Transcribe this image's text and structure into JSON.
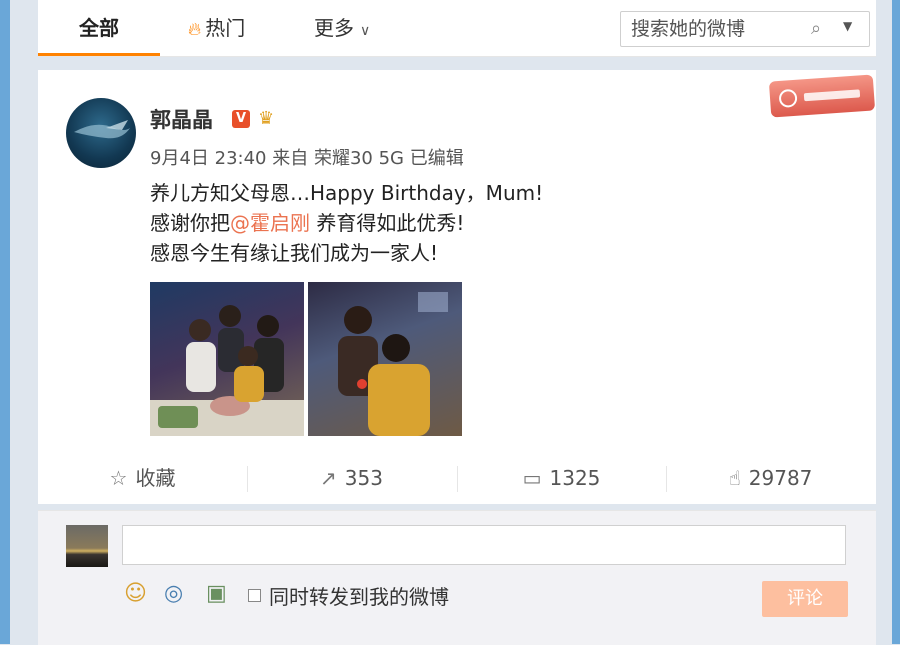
{
  "tabs": {
    "all": "全部",
    "hot": "热门",
    "more": "更多"
  },
  "search": {
    "placeholder": "搜索她的微博"
  },
  "post": {
    "author": "郭晶晶",
    "verified_badge": "V",
    "meta": "9月4日 23:40 来自 荣耀30 5G 已编辑",
    "line1": "养儿方知父母恩…Happy Birthday，Mum!",
    "line2_pre": "感谢你把",
    "mention": "@霍启刚",
    "line2_post": " 养育得如此优秀!",
    "line3": "感恩今生有缘让我们成为一家人!"
  },
  "actions": {
    "favorite": "收藏",
    "repost_count": "353",
    "comment_count": "1325",
    "like_count": "29787"
  },
  "comment_box": {
    "repost_option": "同时转发到我的微博",
    "submit_label": "评论"
  },
  "colors": {
    "accent": "#ff8200",
    "mention": "#eb7350",
    "side_strip": "#6aa7d8",
    "submit_bg": "#fdbf9f"
  },
  "icons": [
    "fire-icon",
    "chevron-down-icon",
    "search-icon",
    "star-icon",
    "share-icon",
    "comment-icon",
    "thumbs-up-icon",
    "emoji-icon",
    "at-icon",
    "image-icon"
  ]
}
